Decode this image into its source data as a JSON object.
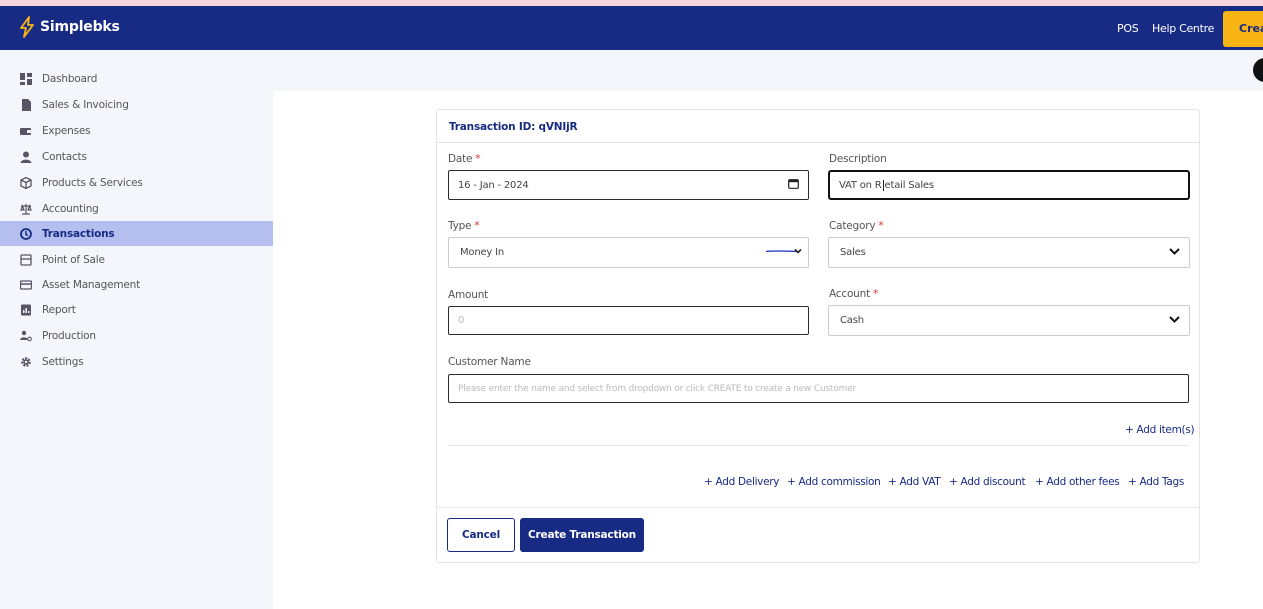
{
  "app": {
    "name": "Simplebks"
  },
  "header": {
    "pos_label": "POS",
    "help_label": "Help Centre",
    "create_label": "Create"
  },
  "sidebar": {
    "items": [
      {
        "label": "Dashboard",
        "icon": "dashboard-icon"
      },
      {
        "label": "Sales & Invoicing",
        "icon": "file-icon"
      },
      {
        "label": "Expenses",
        "icon": "wallet-icon"
      },
      {
        "label": "Contacts",
        "icon": "person-icon"
      },
      {
        "label": "Products & Services",
        "icon": "box-icon"
      },
      {
        "label": "Accounting",
        "icon": "scale-icon"
      },
      {
        "label": "Transactions",
        "icon": "transactions-icon",
        "active": true
      },
      {
        "label": "Point of Sale",
        "icon": "pos-icon"
      },
      {
        "label": "Asset Management",
        "icon": "card-icon"
      },
      {
        "label": "Report",
        "icon": "report-icon"
      },
      {
        "label": "Production",
        "icon": "production-icon"
      },
      {
        "label": "Settings",
        "icon": "gear-icon"
      }
    ]
  },
  "form": {
    "transaction_id": "Transaction ID: qVNIjR",
    "date": {
      "label": "Date",
      "value": "16 - Jan - 2024"
    },
    "description": {
      "label": "Description",
      "value_before_caret": "VAT on R",
      "value_after_caret": "etail Sales"
    },
    "type": {
      "label": "Type",
      "value": "Money In"
    },
    "category": {
      "label": "Category",
      "value": "Sales"
    },
    "amount": {
      "label": "Amount",
      "placeholder": "0"
    },
    "account": {
      "label": "Account",
      "value": "Cash"
    },
    "customer": {
      "label": "Customer Name",
      "placeholder": "Please enter the name and select from dropdown or click CREATE to create a new Customer"
    },
    "required_mark": "*",
    "add_items": "+ Add item(s)",
    "extras": [
      "+ Add Delivery",
      "+ Add commission",
      "+ Add VAT",
      "+ Add discount",
      "+ Add other fees",
      "+ Add Tags"
    ],
    "cancel_label": "Cancel",
    "submit_label": "Create Transaction"
  },
  "colors": {
    "brand": "#172a84",
    "accent": "#f9b416",
    "active_nav": "#b4bff0",
    "sidebar_bg": "#f5f6fc",
    "required": "#dd3333"
  }
}
